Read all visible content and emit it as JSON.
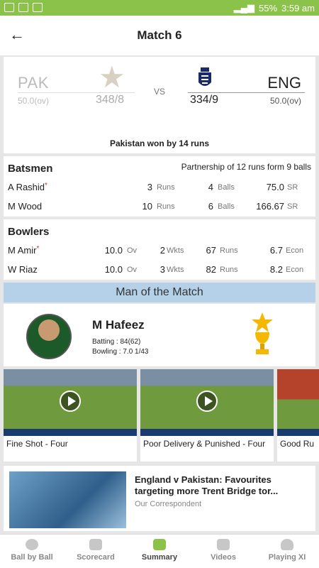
{
  "status_bar": {
    "battery": "55%",
    "time": "3:59 am"
  },
  "header": {
    "back_icon": "arrow-left-icon",
    "title": "Match 6"
  },
  "score": {
    "team_left": {
      "name": "PAK",
      "overs": "50.0(ov)",
      "score": "348/8"
    },
    "vs": "VS",
    "team_right": {
      "name": "ENG",
      "overs": "50.0(ov)",
      "score": "334/9"
    },
    "result": "Pakistan won by 14 runs"
  },
  "batsmen": {
    "title": "Batsmen",
    "partnership": "Partnership of 12 runs form 9 balls",
    "rows": [
      {
        "name": "A Rashid",
        "star": "*",
        "runs": "3",
        "runs_unit": "Runs",
        "balls": "4",
        "balls_unit": "Balls",
        "sr": "75.0",
        "sr_unit": "SR"
      },
      {
        "name": "M Wood",
        "star": "",
        "runs": "10",
        "runs_unit": "Runs",
        "balls": "6",
        "balls_unit": "Balls",
        "sr": "166.67",
        "sr_unit": "SR"
      }
    ]
  },
  "bowlers": {
    "title": "Bowlers",
    "rows": [
      {
        "name": "M Amir",
        "star": "*",
        "overs": "10.0",
        "overs_unit": "Ov",
        "wkts": "2",
        "wkts_unit": "Wkts",
        "runs": "67",
        "runs_unit": "Runs",
        "econ": "6.7",
        "econ_unit": "Econ"
      },
      {
        "name": "W Riaz",
        "star": "",
        "overs": "10.0",
        "overs_unit": "Ov",
        "wkts": "3",
        "wkts_unit": "Wkts",
        "runs": "82",
        "runs_unit": "Runs",
        "econ": "8.2",
        "econ_unit": "Econ"
      }
    ]
  },
  "motm": {
    "band": "Man of the Match",
    "name": "M Hafeez",
    "batting": "Batting :  84(62)",
    "bowling": "Bowling : 7.0  1/43"
  },
  "videos": [
    {
      "caption": "Fine Shot - Four"
    },
    {
      "caption": "Poor Delivery & Punished - Four"
    },
    {
      "caption": "Good Ru"
    }
  ],
  "news": {
    "title": "England v Pakistan: Favourites targeting more Trent Bridge tor...",
    "author": "Our Correspondent"
  },
  "nav": {
    "items": [
      {
        "label": "Ball by Ball",
        "icon": "ball-icon"
      },
      {
        "label": "Scorecard",
        "icon": "shield-icon"
      },
      {
        "label": "Summary",
        "icon": "summary-icon"
      },
      {
        "label": "Videos",
        "icon": "video-icon"
      },
      {
        "label": "Playing XI",
        "icon": "helmet-icon"
      }
    ],
    "active": "Summary"
  },
  "colors": {
    "accent": "#8bc34a",
    "motm_band": "#b5d1ea"
  }
}
